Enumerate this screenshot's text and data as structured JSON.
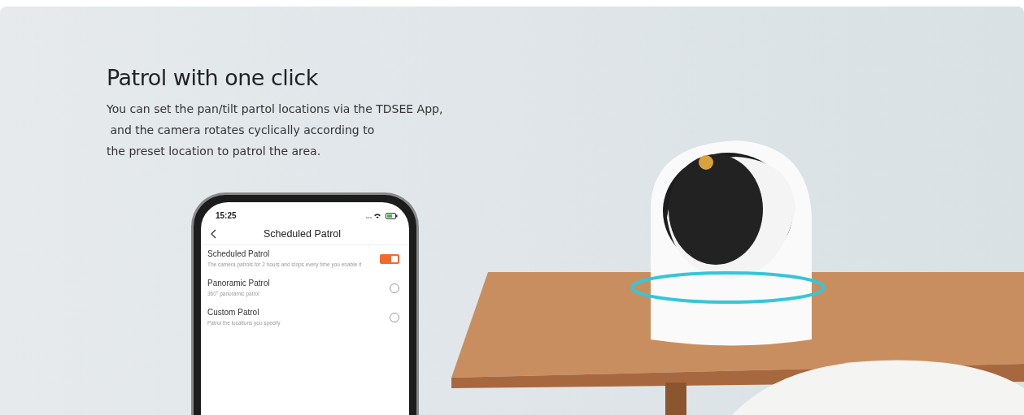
{
  "banner": {
    "kind": "picture",
    "title": "Patrol with one click",
    "description": "You can set the pan/tilt partol locations via the TDSEE App,\n and the camera rotates cyclically according to\nthe preset location to patrol the area."
  },
  "phone": {
    "time": "15:25",
    "title": "Scheduled Patrol",
    "items": [
      {
        "kind": "toggle",
        "title": "Scheduled Patrol",
        "subtitle": "The camera patrols for 2 hours and stops every time you enable it",
        "on": true
      },
      {
        "kind": "radio",
        "title": "Panoramic Patrol",
        "subtitle": "360° panoramic patrol",
        "selected": false
      },
      {
        "kind": "radio",
        "title": "Custom Patrol",
        "subtitle": "Patrol the locations you specify",
        "selected": false
      }
    ]
  }
}
